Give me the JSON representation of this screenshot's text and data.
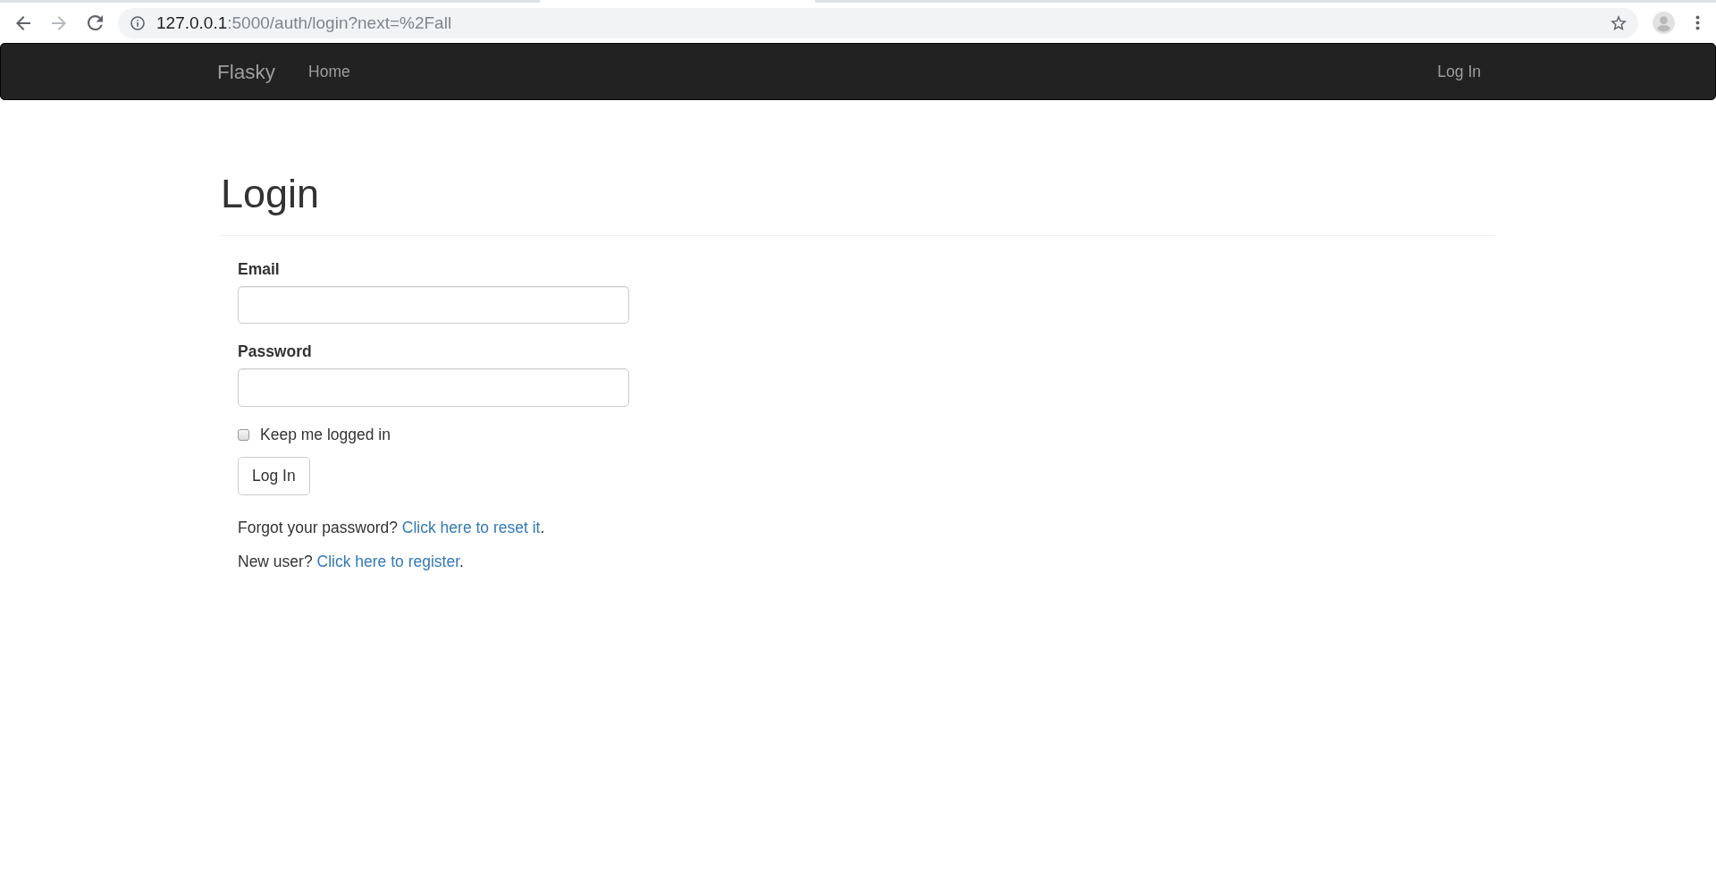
{
  "browser": {
    "forward_disabled": true,
    "address_bar": {
      "host": "127.0.0.1",
      "path": ":5000/auth/login?next=%2Fall"
    }
  },
  "navbar": {
    "brand": "Flasky",
    "left_links": [
      {
        "label": "Home"
      }
    ],
    "right_links": [
      {
        "label": "Log In"
      }
    ]
  },
  "page": {
    "title": "Login"
  },
  "form": {
    "fields": [
      {
        "label": "Email"
      },
      {
        "label": "Password"
      }
    ],
    "remember": {
      "label": "Keep me logged in",
      "checked": false
    },
    "submit": "Log In"
  },
  "help_links": [
    {
      "text": "Forgot your password?",
      "link": "Click here to reset it",
      "suffix": "."
    },
    {
      "text": "New user?",
      "link": "Click here to register",
      "suffix": "."
    }
  ]
}
